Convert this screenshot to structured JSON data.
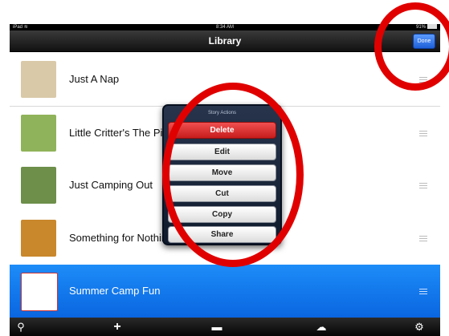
{
  "status_bar": {
    "device": "iPad",
    "wifi_glyph": "≋",
    "time": "8:34 AM",
    "battery": "91%"
  },
  "nav": {
    "title": "Library",
    "done_label": "Done"
  },
  "rows": [
    {
      "label": "Just A Nap",
      "cover_color": "#d9c9a8",
      "selected": false
    },
    {
      "label": "Little Critter's The Picnic",
      "cover_color": "#8fb35a",
      "selected": false
    },
    {
      "label": "Just Camping Out",
      "cover_color": "#6d8f4a",
      "selected": false
    },
    {
      "label": "Something for Nothing",
      "cover_color": "#c9882c",
      "selected": false
    },
    {
      "label": "Summer Camp Fun",
      "cover_color": "#ffffff",
      "selected": true
    }
  ],
  "popover": {
    "title": "Story Actions",
    "actions": [
      "Delete",
      "Edit",
      "Move",
      "Cut",
      "Copy",
      "Share"
    ]
  },
  "toolbar": {
    "search": "⚲",
    "add": "+",
    "new_folder": "▬",
    "cloud": "☁",
    "settings": "⚙"
  },
  "colors": {
    "selection": "#0a66e0",
    "delete": "#d62626",
    "annotation": "#e00000"
  }
}
